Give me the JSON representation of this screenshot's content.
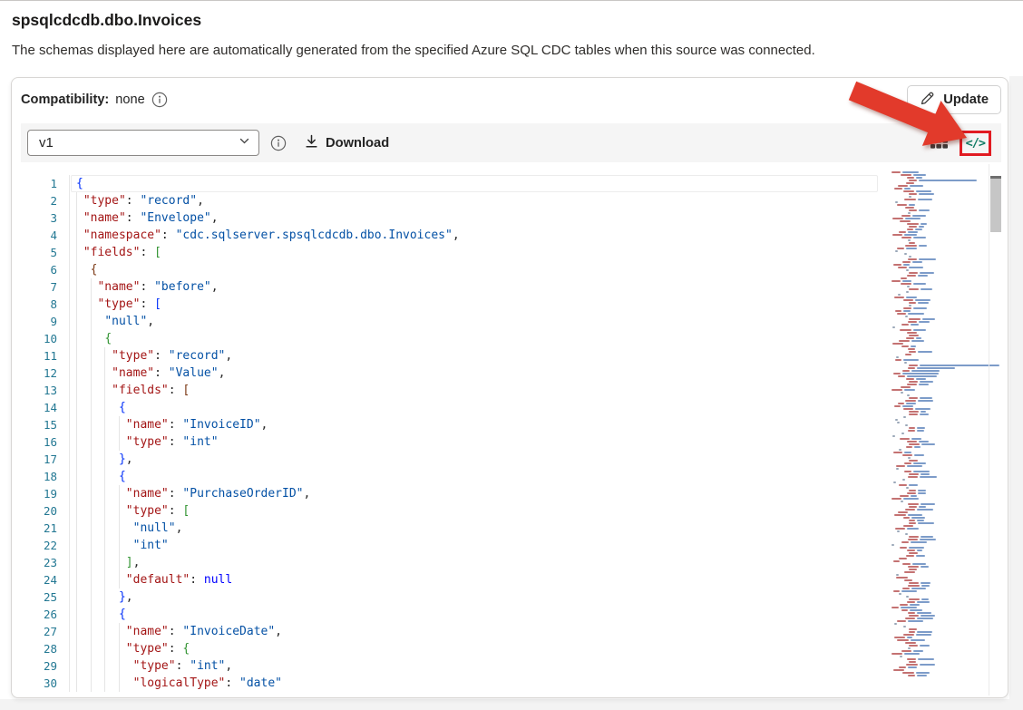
{
  "page": {
    "title": "spsqlcdcdb.dbo.Invoices",
    "subtitle": "The schemas displayed here are automatically generated from the specified Azure SQL CDC tables when this source was connected."
  },
  "panel": {
    "compatibility_label": "Compatibility:",
    "compatibility_value": "none",
    "update_label": "Update"
  },
  "toolbar": {
    "version_selected": "v1",
    "download_label": "Download"
  },
  "icons": {
    "update_icon": "pencil-icon",
    "compatibility_info_icon": "info-icon",
    "version_info_icon": "info-icon",
    "download_icon": "download-arrow-icon",
    "table_view_icon": "table-grid-icon",
    "code_view_icon": "code-brackets-icon",
    "code_view_glyph": "</>",
    "dropdown_icon": "chevron-down-icon"
  },
  "annotations": {
    "arrow": "red-arrow-pointing-to-code-view-icon",
    "highlight_box": "red-rectangle-around-code-view-icon"
  },
  "colors": {
    "key": "#a31515",
    "string": "#0451a5",
    "keyword": "#0000ff",
    "line_number": "#237893",
    "bracket_depth": [
      "#0431fa",
      "#319331",
      "#7b3814"
    ],
    "annotation_red": "#e23a2b",
    "teal_icon": "#0e7a63",
    "minimap_key": "#c47272",
    "minimap_string": "#7d9cc9",
    "minimap_punct": "#9aa7b8"
  },
  "editor": {
    "lines": [
      "{",
      " \"type\": \"record\",",
      " \"name\": \"Envelope\",",
      " \"namespace\": \"cdc.sqlserver.spsqlcdcdb.dbo.Invoices\",",
      " \"fields\": [",
      "  {",
      "   \"name\": \"before\",",
      "   \"type\": [",
      "    \"null\",",
      "    {",
      "     \"type\": \"record\",",
      "     \"name\": \"Value\",",
      "     \"fields\": [",
      "      {",
      "       \"name\": \"InvoiceID\",",
      "       \"type\": \"int\"",
      "      },",
      "      {",
      "       \"name\": \"PurchaseOrderID\",",
      "       \"type\": [",
      "        \"null\",",
      "        \"int\"",
      "       ],",
      "       \"default\": null",
      "      },",
      "      {",
      "       \"name\": \"InvoiceDate\",",
      "       \"type\": {",
      "        \"type\": \"int\",",
      "        \"logicalType\": \"date\""
    ]
  }
}
